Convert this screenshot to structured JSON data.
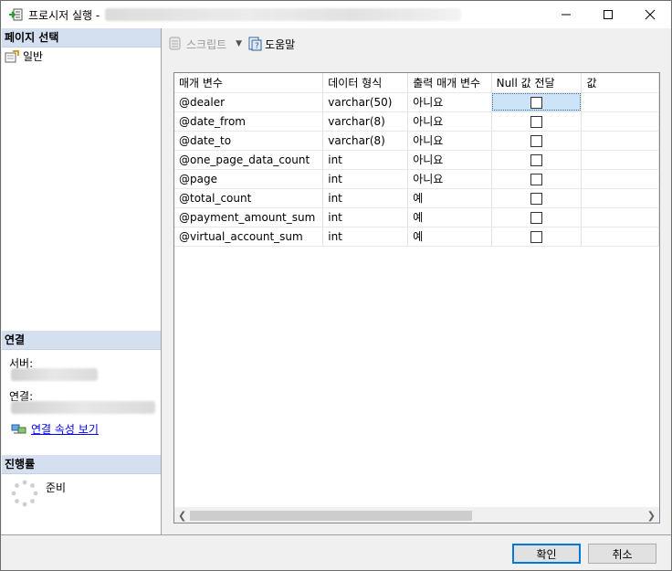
{
  "window": {
    "title": "프로시저 실행 -"
  },
  "left_pane": {
    "page_select_header": "페이지 선택",
    "page_items": [
      {
        "label": "일반",
        "icon": "general-page-icon"
      }
    ],
    "connection_header": "연결",
    "server_label": "서버:",
    "connection_label": "연결:",
    "view_connection_properties": "연결 속성 보기",
    "progress_header": "진행률",
    "progress_status": "준비"
  },
  "toolbar": {
    "script_label": "스크립트",
    "help_label": "도움말"
  },
  "grid": {
    "columns": [
      "매개 변수",
      "데이터 형식",
      "출력 매개 변수",
      "Null 값 전달",
      "값"
    ],
    "rows": [
      {
        "param": "@dealer",
        "type": "varchar(50)",
        "output": "아니요"
      },
      {
        "param": "@date_from",
        "type": "varchar(8)",
        "output": "아니요"
      },
      {
        "param": "@date_to",
        "type": "varchar(8)",
        "output": "아니요"
      },
      {
        "param": "@one_page_data_count",
        "type": "int",
        "output": "아니요"
      },
      {
        "param": "@page",
        "type": "int",
        "output": "아니요"
      },
      {
        "param": "@total_count",
        "type": "int",
        "output": "예"
      },
      {
        "param": "@payment_amount_sum",
        "type": "int",
        "output": "예"
      },
      {
        "param": "@virtual_account_sum",
        "type": "int",
        "output": "예"
      }
    ]
  },
  "buttons": {
    "ok": "확인",
    "cancel": "취소"
  },
  "colors": {
    "section_header_bg": "#d4dff0",
    "selected_cell_bg": "#cde3f8",
    "link": "#0000ee",
    "ok_border": "#0078d7"
  }
}
